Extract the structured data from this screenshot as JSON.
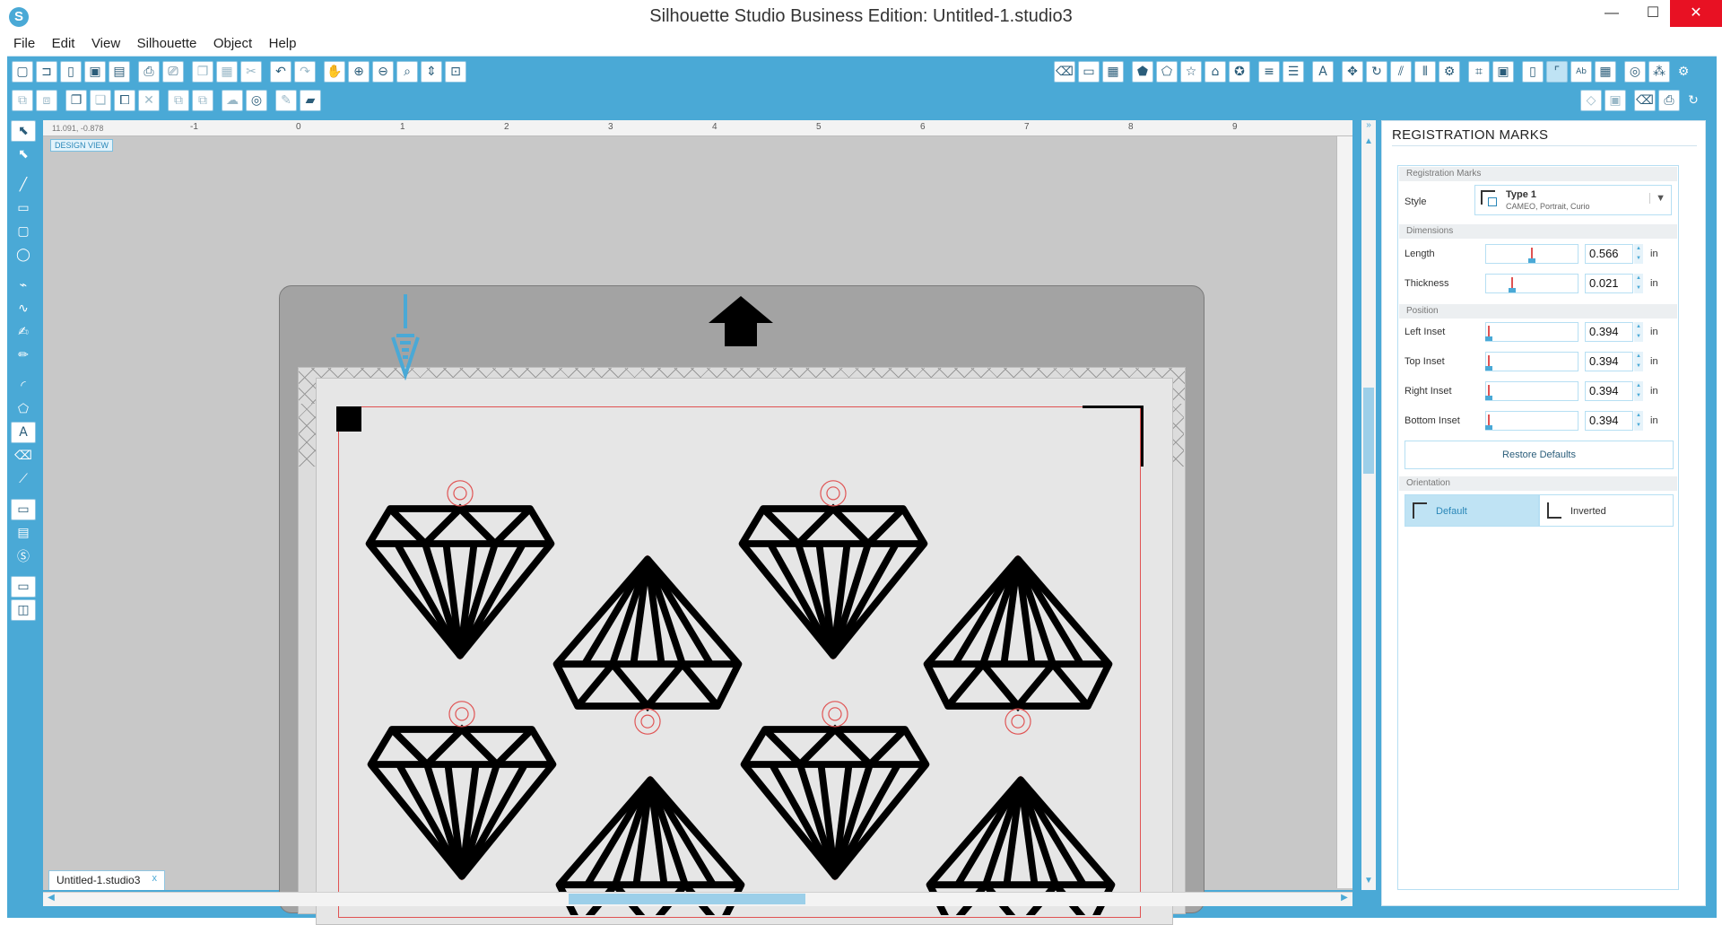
{
  "window": {
    "title": "Silhouette Studio Business Edition: Untitled-1.studio3",
    "logo_glyph": "S",
    "minimize": "—",
    "maximize": "☐",
    "close": "✕"
  },
  "menu": [
    "File",
    "Edit",
    "View",
    "Silhouette",
    "Object",
    "Help"
  ],
  "ruler": {
    "coordinates": "11.091, -0.878",
    "top_ticks": [
      "-1",
      "0",
      "1",
      "2",
      "3",
      "4",
      "5",
      "6",
      "7",
      "8",
      "9"
    ]
  },
  "canvas": {
    "view_badge": "DESIGN VIEW"
  },
  "document_tab": {
    "label": "Untitled-1.studio3",
    "close": "x"
  },
  "panel": {
    "title": "REGISTRATION MARKS",
    "sections": {
      "registration_marks": "Registration Marks",
      "dimensions": "Dimensions",
      "position": "Position",
      "orientation": "Orientation"
    },
    "style": {
      "label": "Style",
      "name": "Type 1",
      "subtitle": "CAMEO, Portrait, Curio"
    },
    "fields": [
      {
        "label": "Length",
        "value": "0.566",
        "unit": "in",
        "slider_fraction": 0.5
      },
      {
        "label": "Thickness",
        "value": "0.021",
        "unit": "in",
        "slider_fraction": 0.28
      },
      {
        "label": "Left Inset",
        "value": "0.394",
        "unit": "in",
        "slider_fraction": 0.02
      },
      {
        "label": "Top Inset",
        "value": "0.394",
        "unit": "in",
        "slider_fraction": 0.02
      },
      {
        "label": "Right Inset",
        "value": "0.394",
        "unit": "in",
        "slider_fraction": 0.02
      },
      {
        "label": "Bottom Inset",
        "value": "0.394",
        "unit": "in",
        "slider_fraction": 0.02
      }
    ],
    "restore_button": "Restore Defaults",
    "orientation_options": [
      {
        "label": "Default",
        "selected": true
      },
      {
        "label": "Inverted",
        "selected": false
      }
    ]
  },
  "colors": {
    "chrome_blue": "#4aa9d6",
    "cut_line_red": "#e05252",
    "selection_blue": "#bfe3f4"
  }
}
